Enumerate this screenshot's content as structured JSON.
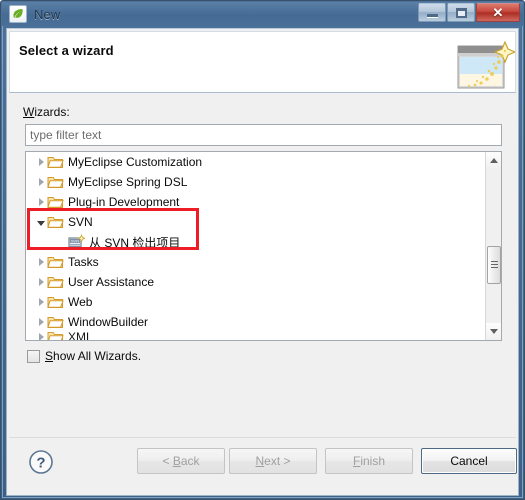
{
  "window": {
    "title": "New",
    "title_icon": "myeclipse-leaf-icon",
    "controls": {
      "minimize": "minimize-icon",
      "maximize": "maximize-icon",
      "close": "close-icon",
      "close_glyph": "✕"
    }
  },
  "banner": {
    "title": "Select a wizard",
    "icon": "wizard-sparkle-icon"
  },
  "form": {
    "wizards_label_mnemonic": "W",
    "wizards_label_rest": "izards:",
    "filter_placeholder": "type filter text",
    "filter_value": ""
  },
  "tree": {
    "items": [
      {
        "label": "MyEclipse Customization",
        "state": "collapsed",
        "level": 0,
        "icon": "folder-icon"
      },
      {
        "label": "MyEclipse Spring DSL",
        "state": "collapsed",
        "level": 0,
        "icon": "folder-icon"
      },
      {
        "label": "Plug-in Development",
        "state": "collapsed",
        "level": 0,
        "icon": "folder-icon"
      },
      {
        "label": "SVN",
        "state": "expanded",
        "level": 0,
        "icon": "folder-icon"
      },
      {
        "label": "从 SVN 检出项目",
        "state": "leaf",
        "level": 1,
        "icon": "svn-checkout-icon"
      },
      {
        "label": "Tasks",
        "state": "collapsed",
        "level": 0,
        "icon": "folder-icon"
      },
      {
        "label": "User Assistance",
        "state": "collapsed",
        "level": 0,
        "icon": "folder-icon"
      },
      {
        "label": "Web",
        "state": "collapsed",
        "level": 0,
        "icon": "folder-icon"
      },
      {
        "label": "WindowBuilder",
        "state": "collapsed",
        "level": 0,
        "icon": "folder-icon"
      },
      {
        "label": "XML",
        "state": "collapsed",
        "level": 0,
        "icon": "folder-icon",
        "clipped": true
      }
    ],
    "highlight": {
      "color": "#ee1c25",
      "from_index": 3,
      "to_index": 4
    },
    "scrollbar": {
      "up_arrow": "scroll-up-icon",
      "down_arrow": "scroll-down-icon",
      "thumb_position_pct": 66
    }
  },
  "options": {
    "show_all_wizards_mnemonic": "S",
    "show_all_wizards_rest": "how All Wizards.",
    "show_all_wizards_checked": false
  },
  "buttons": {
    "help": "?",
    "back_pre": "< ",
    "back_mn": "B",
    "back_post": "ack",
    "next_mn": "N",
    "next_post": "ext >",
    "finish_mn": "F",
    "finish_post": "inish",
    "cancel": "Cancel",
    "back_enabled": false,
    "next_enabled": false,
    "finish_enabled": false,
    "cancel_enabled": true
  }
}
